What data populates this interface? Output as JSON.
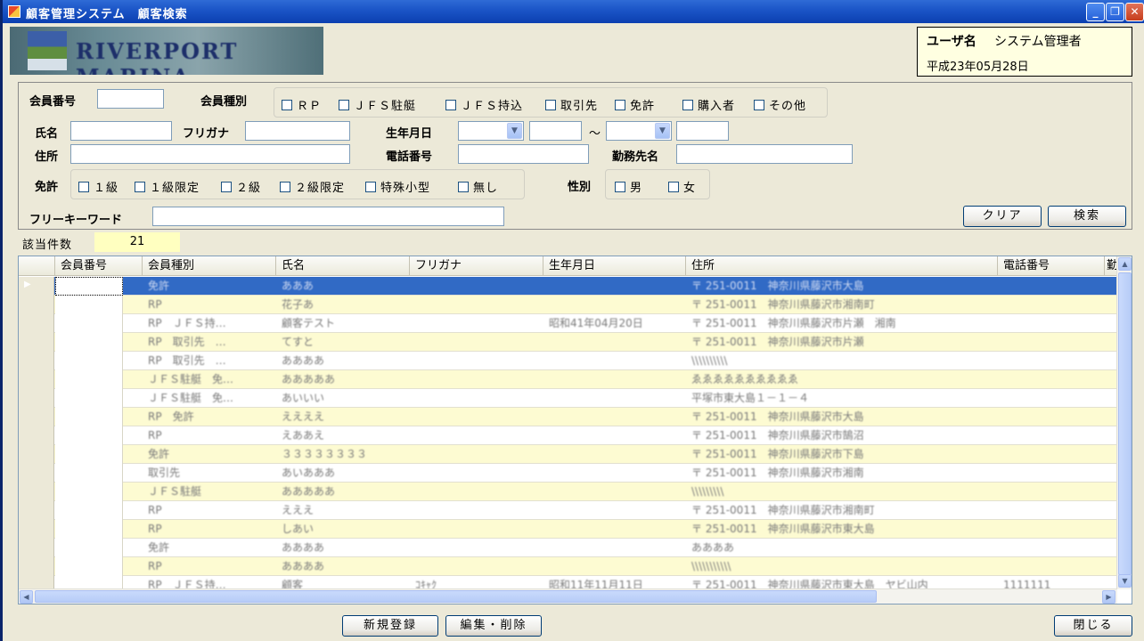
{
  "window": {
    "title": "顧客管理システム　顧客検索",
    "buttons": {
      "minimize": "_",
      "maximize": "❐",
      "close": "✕"
    }
  },
  "logo": {
    "text": "RIVERPORT MARINA"
  },
  "user": {
    "label": "ユーザ名",
    "name": "システム管理者",
    "date": "平成23年05月28日"
  },
  "search": {
    "member_no_label": "会員番号",
    "member_no_value": "",
    "member_type_label": "会員種別",
    "member_types": [
      "ＲＰ",
      "ＪＦＳ駐艇",
      "ＪＦＳ持込",
      "取引先",
      "免許",
      "購入者",
      "その他"
    ],
    "name_label": "氏名",
    "kana_label": "フリガナ",
    "birth_label": "生年月日",
    "birth_tilde": "～",
    "address_label": "住所",
    "phone_label": "電話番号",
    "workplace_label": "勤務先名",
    "license_label": "免許",
    "licenses": [
      "１級",
      "１級限定",
      "２級",
      "２級限定",
      "特殊小型",
      "無し"
    ],
    "gender_label": "性別",
    "genders": [
      "男",
      "女"
    ],
    "keyword_label": "フリーキーワード",
    "clear_button": "クリア",
    "search_button": "検索"
  },
  "count": {
    "label": "該当件数",
    "value": "21"
  },
  "grid": {
    "columns": [
      "会員番号",
      "会員種別",
      "氏名",
      "フリガナ",
      "生年月日",
      "住所",
      "電話番号",
      "勤"
    ],
    "rows": [
      {
        "type": "免許",
        "name": "あああ",
        "kana": "",
        "birth": "",
        "address": "〒 251-0011　神奈川県藤沢市大島",
        "phone": ""
      },
      {
        "type": "RP",
        "name": "花子あ",
        "kana": "",
        "birth": "",
        "address": "〒 251-0011　神奈川県藤沢市湘南町",
        "phone": ""
      },
      {
        "type": "RP　ＪＦＳ持…",
        "name": "顧客テスト",
        "kana": "",
        "birth": "昭和41年04月20日",
        "address": "〒 251-0011　神奈川県藤沢市片瀬　湘南",
        "phone": ""
      },
      {
        "type": "RP　取引先　…",
        "name": "てすと",
        "kana": "",
        "birth": "",
        "address": "〒 251-0011　神奈川県藤沢市片瀬",
        "phone": ""
      },
      {
        "type": "RP　取引先　…",
        "name": "ああああ",
        "kana": "",
        "birth": "",
        "address": "\\\\\\\\\\\\\\\\\\\\",
        "phone": ""
      },
      {
        "type": "ＪＦＳ駐艇　免…",
        "name": "あああああ",
        "kana": "",
        "birth": "",
        "address": "ゑゑゑゑゑゑゑゑゑゑ",
        "phone": ""
      },
      {
        "type": "ＪＦＳ駐艇　免…",
        "name": "あいいい",
        "kana": "",
        "birth": "",
        "address": "平塚市東大島１－１－４",
        "phone": ""
      },
      {
        "type": "RP　免許",
        "name": "ええええ",
        "kana": "",
        "birth": "",
        "address": "〒 251-0011　神奈川県藤沢市大島",
        "phone": ""
      },
      {
        "type": "RP",
        "name": "えああえ",
        "kana": "",
        "birth": "",
        "address": "〒 251-0011　神奈川県藤沢市鵠沼",
        "phone": ""
      },
      {
        "type": "免許",
        "name": "３３３３３３３３",
        "kana": "",
        "birth": "",
        "address": "〒 251-0011　神奈川県藤沢市下島",
        "phone": ""
      },
      {
        "type": "取引先",
        "name": "あいあああ",
        "kana": "",
        "birth": "",
        "address": "〒 251-0011　神奈川県藤沢市湘南",
        "phone": ""
      },
      {
        "type": "ＪＦＳ駐艇",
        "name": "あああああ",
        "kana": "",
        "birth": "",
        "address": "\\\\\\\\\\\\\\\\\\",
        "phone": ""
      },
      {
        "type": "RP",
        "name": "えええ",
        "kana": "",
        "birth": "",
        "address": "〒 251-0011　神奈川県藤沢市湘南町",
        "phone": ""
      },
      {
        "type": "RP",
        "name": "しあい",
        "kana": "",
        "birth": "",
        "address": "〒 251-0011　神奈川県藤沢市東大島",
        "phone": ""
      },
      {
        "type": "免許",
        "name": "ああああ",
        "kana": "",
        "birth": "",
        "address": "ああああ",
        "phone": ""
      },
      {
        "type": "RP",
        "name": "ああああ",
        "kana": "",
        "birth": "",
        "address": "\\\\\\\\\\\\\\\\\\\\\\",
        "phone": ""
      },
      {
        "type": "RP　ＪＦＳ持…",
        "name": "顧客",
        "kana": "ｺｷｬｸ",
        "birth": "昭和11年11月11日",
        "address": "〒 251-0011　神奈川県藤沢市東大島　ヤビ山内",
        "phone": "1111111"
      }
    ]
  },
  "footer": {
    "new_button": "新規登録",
    "edit_button": "編集・削除",
    "close_button": "閉じる"
  }
}
